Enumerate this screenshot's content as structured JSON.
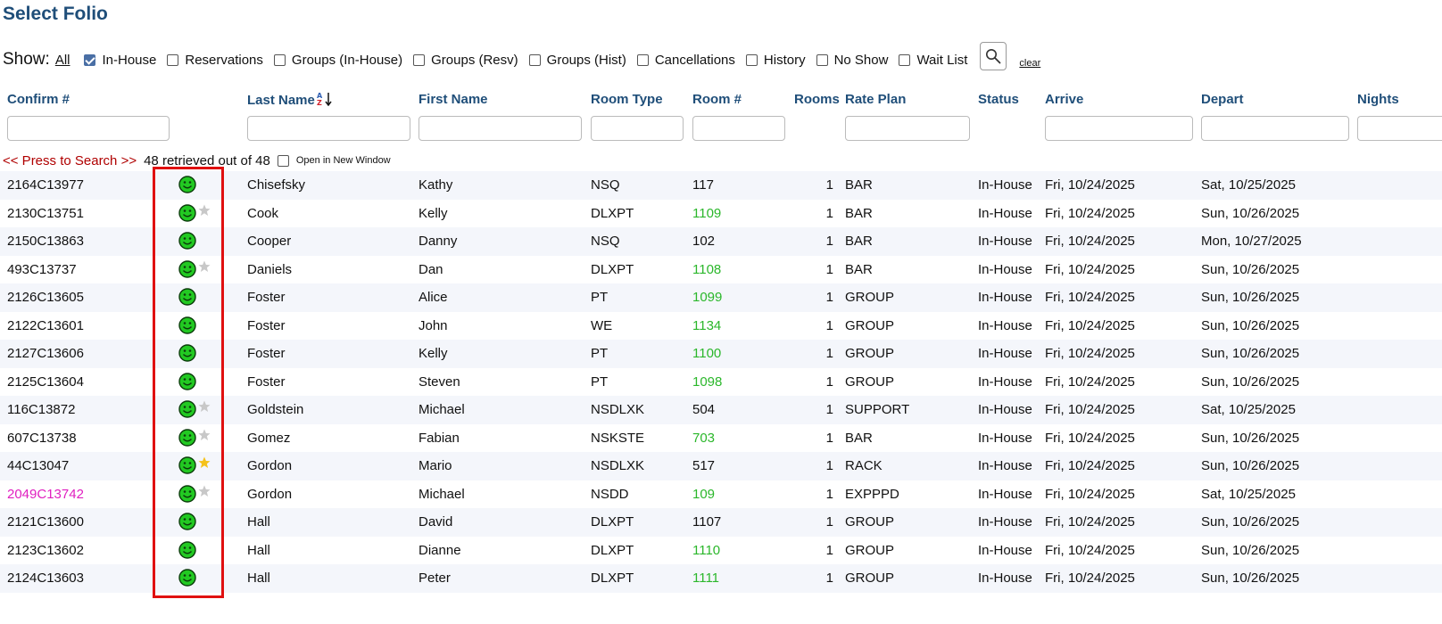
{
  "page_title": "Select Folio",
  "show": {
    "label": "Show:",
    "all_link": "All",
    "filters": [
      {
        "label": "In-House",
        "checked": true
      },
      {
        "label": "Reservations",
        "checked": false
      },
      {
        "label": "Groups (In-House)",
        "checked": false
      },
      {
        "label": "Groups (Resv)",
        "checked": false
      },
      {
        "label": "Groups (Hist)",
        "checked": false
      },
      {
        "label": "Cancellations",
        "checked": false
      },
      {
        "label": "History",
        "checked": false
      },
      {
        "label": "No Show",
        "checked": false
      },
      {
        "label": "Wait List",
        "checked": false
      }
    ],
    "search_icon": "search-icon",
    "clear_link": "clear"
  },
  "columns": {
    "confirm": "Confirm #",
    "last_name": "Last Name",
    "first_name": "First Name",
    "room_type": "Room Type",
    "room_num": "Room #",
    "rooms": "Rooms",
    "rate_plan": "Rate Plan",
    "status": "Status",
    "arrive": "Arrive",
    "depart": "Depart",
    "nights": "Nights"
  },
  "search_row": {
    "press_link": "<< Press to Search >>",
    "retrieved": "48 retrieved out of 48",
    "open_new_window": "Open in New Window"
  },
  "colors": {
    "title": "#1f4e79",
    "room_highlight": "#2bb72b",
    "confirm_highlight": "#e020c0",
    "smiley": "#22c922",
    "star_gray": "#c8c8c8",
    "star_gold": "#f5c21a",
    "highlight_box": "#e01010"
  },
  "rows": [
    {
      "confirm": "2164C13977",
      "star": "none",
      "last": "Chisefsky",
      "first": "Kathy",
      "room_type": "NSQ",
      "room": "117",
      "room_green": false,
      "rooms": "1",
      "rate": "BAR",
      "status": "In-House",
      "arrive": "Fri, 10/24/2025",
      "depart": "Sat, 10/25/2025",
      "confirm_pink": false
    },
    {
      "confirm": "2130C13751",
      "star": "gray",
      "last": "Cook",
      "first": "Kelly",
      "room_type": "DLXPT",
      "room": "1109",
      "room_green": true,
      "rooms": "1",
      "rate": "BAR",
      "status": "In-House",
      "arrive": "Fri, 10/24/2025",
      "depart": "Sun, 10/26/2025",
      "confirm_pink": false
    },
    {
      "confirm": "2150C13863",
      "star": "none",
      "last": "Cooper",
      "first": "Danny",
      "room_type": "NSQ",
      "room": "102",
      "room_green": false,
      "rooms": "1",
      "rate": "BAR",
      "status": "In-House",
      "arrive": "Fri, 10/24/2025",
      "depart": "Mon, 10/27/2025",
      "confirm_pink": false
    },
    {
      "confirm": "493C13737",
      "star": "gray",
      "last": "Daniels",
      "first": "Dan",
      "room_type": "DLXPT",
      "room": "1108",
      "room_green": true,
      "rooms": "1",
      "rate": "BAR",
      "status": "In-House",
      "arrive": "Fri, 10/24/2025",
      "depart": "Sun, 10/26/2025",
      "confirm_pink": false
    },
    {
      "confirm": "2126C13605",
      "star": "none",
      "last": "Foster",
      "first": "Alice",
      "room_type": "PT",
      "room": "1099",
      "room_green": true,
      "rooms": "1",
      "rate": "GROUP",
      "status": "In-House",
      "arrive": "Fri, 10/24/2025",
      "depart": "Sun, 10/26/2025",
      "confirm_pink": false
    },
    {
      "confirm": "2122C13601",
      "star": "none",
      "last": "Foster",
      "first": "John",
      "room_type": "WE",
      "room": "1134",
      "room_green": true,
      "rooms": "1",
      "rate": "GROUP",
      "status": "In-House",
      "arrive": "Fri, 10/24/2025",
      "depart": "Sun, 10/26/2025",
      "confirm_pink": false
    },
    {
      "confirm": "2127C13606",
      "star": "none",
      "last": "Foster",
      "first": "Kelly",
      "room_type": "PT",
      "room": "1100",
      "room_green": true,
      "rooms": "1",
      "rate": "GROUP",
      "status": "In-House",
      "arrive": "Fri, 10/24/2025",
      "depart": "Sun, 10/26/2025",
      "confirm_pink": false
    },
    {
      "confirm": "2125C13604",
      "star": "none",
      "last": "Foster",
      "first": "Steven",
      "room_type": "PT",
      "room": "1098",
      "room_green": true,
      "rooms": "1",
      "rate": "GROUP",
      "status": "In-House",
      "arrive": "Fri, 10/24/2025",
      "depart": "Sun, 10/26/2025",
      "confirm_pink": false
    },
    {
      "confirm": "116C13872",
      "star": "gray",
      "last": "Goldstein",
      "first": "Michael",
      "room_type": "NSDLXK",
      "room": "504",
      "room_green": false,
      "rooms": "1",
      "rate": "SUPPORT",
      "status": "In-House",
      "arrive": "Fri, 10/24/2025",
      "depart": "Sat, 10/25/2025",
      "confirm_pink": false
    },
    {
      "confirm": "607C13738",
      "star": "gray",
      "last": "Gomez",
      "first": "Fabian",
      "room_type": "NSKSTE",
      "room": "703",
      "room_green": true,
      "rooms": "1",
      "rate": "BAR",
      "status": "In-House",
      "arrive": "Fri, 10/24/2025",
      "depart": "Sun, 10/26/2025",
      "confirm_pink": false
    },
    {
      "confirm": "44C13047",
      "star": "gold",
      "last": "Gordon",
      "first": "Mario",
      "room_type": "NSDLXK",
      "room": "517",
      "room_green": false,
      "rooms": "1",
      "rate": "RACK",
      "status": "In-House",
      "arrive": "Fri, 10/24/2025",
      "depart": "Sun, 10/26/2025",
      "confirm_pink": false
    },
    {
      "confirm": "2049C13742",
      "star": "gray",
      "last": "Gordon",
      "first": "Michael",
      "room_type": "NSDD",
      "room": "109",
      "room_green": true,
      "rooms": "1",
      "rate": "EXPPPD",
      "status": "In-House",
      "arrive": "Fri, 10/24/2025",
      "depart": "Sat, 10/25/2025",
      "confirm_pink": true
    },
    {
      "confirm": "2121C13600",
      "star": "none",
      "last": "Hall",
      "first": "David",
      "room_type": "DLXPT",
      "room": "1107",
      "room_green": false,
      "rooms": "1",
      "rate": "GROUP",
      "status": "In-House",
      "arrive": "Fri, 10/24/2025",
      "depart": "Sun, 10/26/2025",
      "confirm_pink": false
    },
    {
      "confirm": "2123C13602",
      "star": "none",
      "last": "Hall",
      "first": "Dianne",
      "room_type": "DLXPT",
      "room": "1110",
      "room_green": true,
      "rooms": "1",
      "rate": "GROUP",
      "status": "In-House",
      "arrive": "Fri, 10/24/2025",
      "depart": "Sun, 10/26/2025",
      "confirm_pink": false
    },
    {
      "confirm": "2124C13603",
      "star": "none",
      "last": "Hall",
      "first": "Peter",
      "room_type": "DLXPT",
      "room": "1111",
      "room_green": true,
      "rooms": "1",
      "rate": "GROUP",
      "status": "In-House",
      "arrive": "Fri, 10/24/2025",
      "depart": "Sun, 10/26/2025",
      "confirm_pink": false
    }
  ]
}
